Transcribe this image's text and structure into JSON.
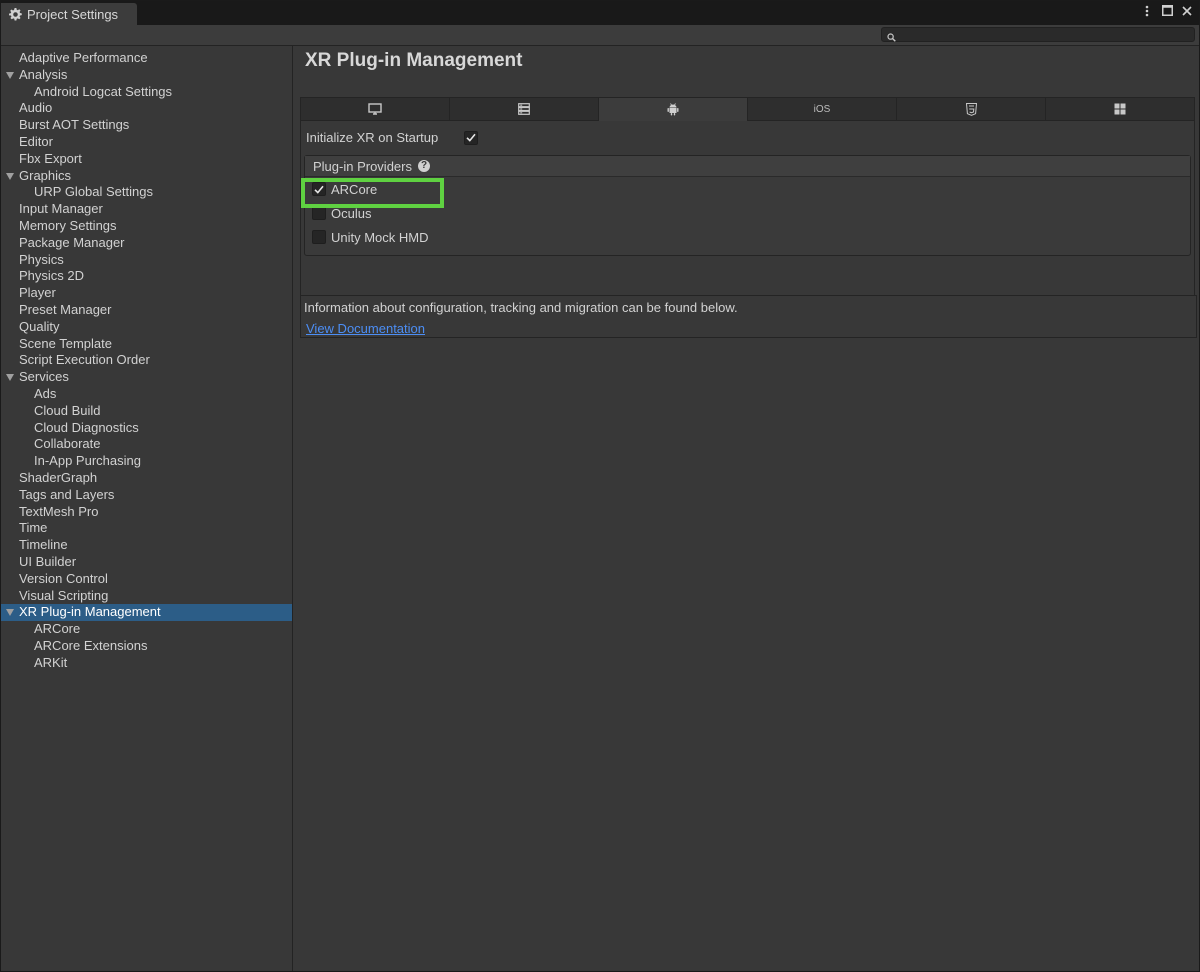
{
  "window": {
    "tab_title": "Project Settings"
  },
  "search": {
    "placeholder": "",
    "value": ""
  },
  "sidebar": {
    "items": [
      {
        "label": "Adaptive Performance",
        "level": 0,
        "foldout": false
      },
      {
        "label": "Analysis",
        "level": 0,
        "foldout": true
      },
      {
        "label": "Android Logcat Settings",
        "level": 1,
        "foldout": false
      },
      {
        "label": "Audio",
        "level": 0,
        "foldout": false
      },
      {
        "label": "Burst AOT Settings",
        "level": 0,
        "foldout": false
      },
      {
        "label": "Editor",
        "level": 0,
        "foldout": false
      },
      {
        "label": "Fbx Export",
        "level": 0,
        "foldout": false
      },
      {
        "label": "Graphics",
        "level": 0,
        "foldout": true
      },
      {
        "label": "URP Global Settings",
        "level": 1,
        "foldout": false
      },
      {
        "label": "Input Manager",
        "level": 0,
        "foldout": false
      },
      {
        "label": "Memory Settings",
        "level": 0,
        "foldout": false
      },
      {
        "label": "Package Manager",
        "level": 0,
        "foldout": false
      },
      {
        "label": "Physics",
        "level": 0,
        "foldout": false
      },
      {
        "label": "Physics 2D",
        "level": 0,
        "foldout": false
      },
      {
        "label": "Player",
        "level": 0,
        "foldout": false
      },
      {
        "label": "Preset Manager",
        "level": 0,
        "foldout": false
      },
      {
        "label": "Quality",
        "level": 0,
        "foldout": false
      },
      {
        "label": "Scene Template",
        "level": 0,
        "foldout": false
      },
      {
        "label": "Script Execution Order",
        "level": 0,
        "foldout": false
      },
      {
        "label": "Services",
        "level": 0,
        "foldout": true
      },
      {
        "label": "Ads",
        "level": 1,
        "foldout": false
      },
      {
        "label": "Cloud Build",
        "level": 1,
        "foldout": false
      },
      {
        "label": "Cloud Diagnostics",
        "level": 1,
        "foldout": false
      },
      {
        "label": "Collaborate",
        "level": 1,
        "foldout": false
      },
      {
        "label": "In-App Purchasing",
        "level": 1,
        "foldout": false
      },
      {
        "label": "ShaderGraph",
        "level": 0,
        "foldout": false
      },
      {
        "label": "Tags and Layers",
        "level": 0,
        "foldout": false
      },
      {
        "label": "TextMesh Pro",
        "level": 0,
        "foldout": false
      },
      {
        "label": "Time",
        "level": 0,
        "foldout": false
      },
      {
        "label": "Timeline",
        "level": 0,
        "foldout": false
      },
      {
        "label": "UI Builder",
        "level": 0,
        "foldout": false
      },
      {
        "label": "Version Control",
        "level": 0,
        "foldout": false
      },
      {
        "label": "Visual Scripting",
        "level": 0,
        "foldout": false
      },
      {
        "label": "XR Plug-in Management",
        "level": 0,
        "foldout": true,
        "selected": true
      },
      {
        "label": "ARCore",
        "level": 1,
        "foldout": false
      },
      {
        "label": "ARCore Extensions",
        "level": 1,
        "foldout": false
      },
      {
        "label": "ARKit",
        "level": 1,
        "foldout": false
      }
    ]
  },
  "main": {
    "title": "XR Plug-in Management",
    "platform_tabs": [
      {
        "id": "standalone",
        "icon": "monitor-icon",
        "label": "",
        "active": false
      },
      {
        "id": "server",
        "icon": "server-icon",
        "label": "",
        "active": false
      },
      {
        "id": "android",
        "icon": "android-icon",
        "label": "",
        "active": true
      },
      {
        "id": "ios",
        "icon": "",
        "label": "iOS",
        "active": false
      },
      {
        "id": "webgl",
        "icon": "html5-icon",
        "label": "",
        "active": false
      },
      {
        "id": "windows",
        "icon": "windows-icon",
        "label": "",
        "active": false
      }
    ],
    "init_xr_label": "Initialize XR on Startup",
    "init_xr_checked": true,
    "providers_header": "Plug-in Providers",
    "providers": [
      {
        "label": "ARCore",
        "checked": true
      },
      {
        "label": "Oculus",
        "checked": false
      },
      {
        "label": "Unity Mock HMD",
        "checked": false
      }
    ],
    "info_text": "Information about configuration, tracking and migration can be found below.",
    "doc_link": "View Documentation"
  },
  "colors": {
    "selection": "#2c5d87",
    "highlight_box": "#5fd141",
    "link": "#4c8ef5"
  }
}
